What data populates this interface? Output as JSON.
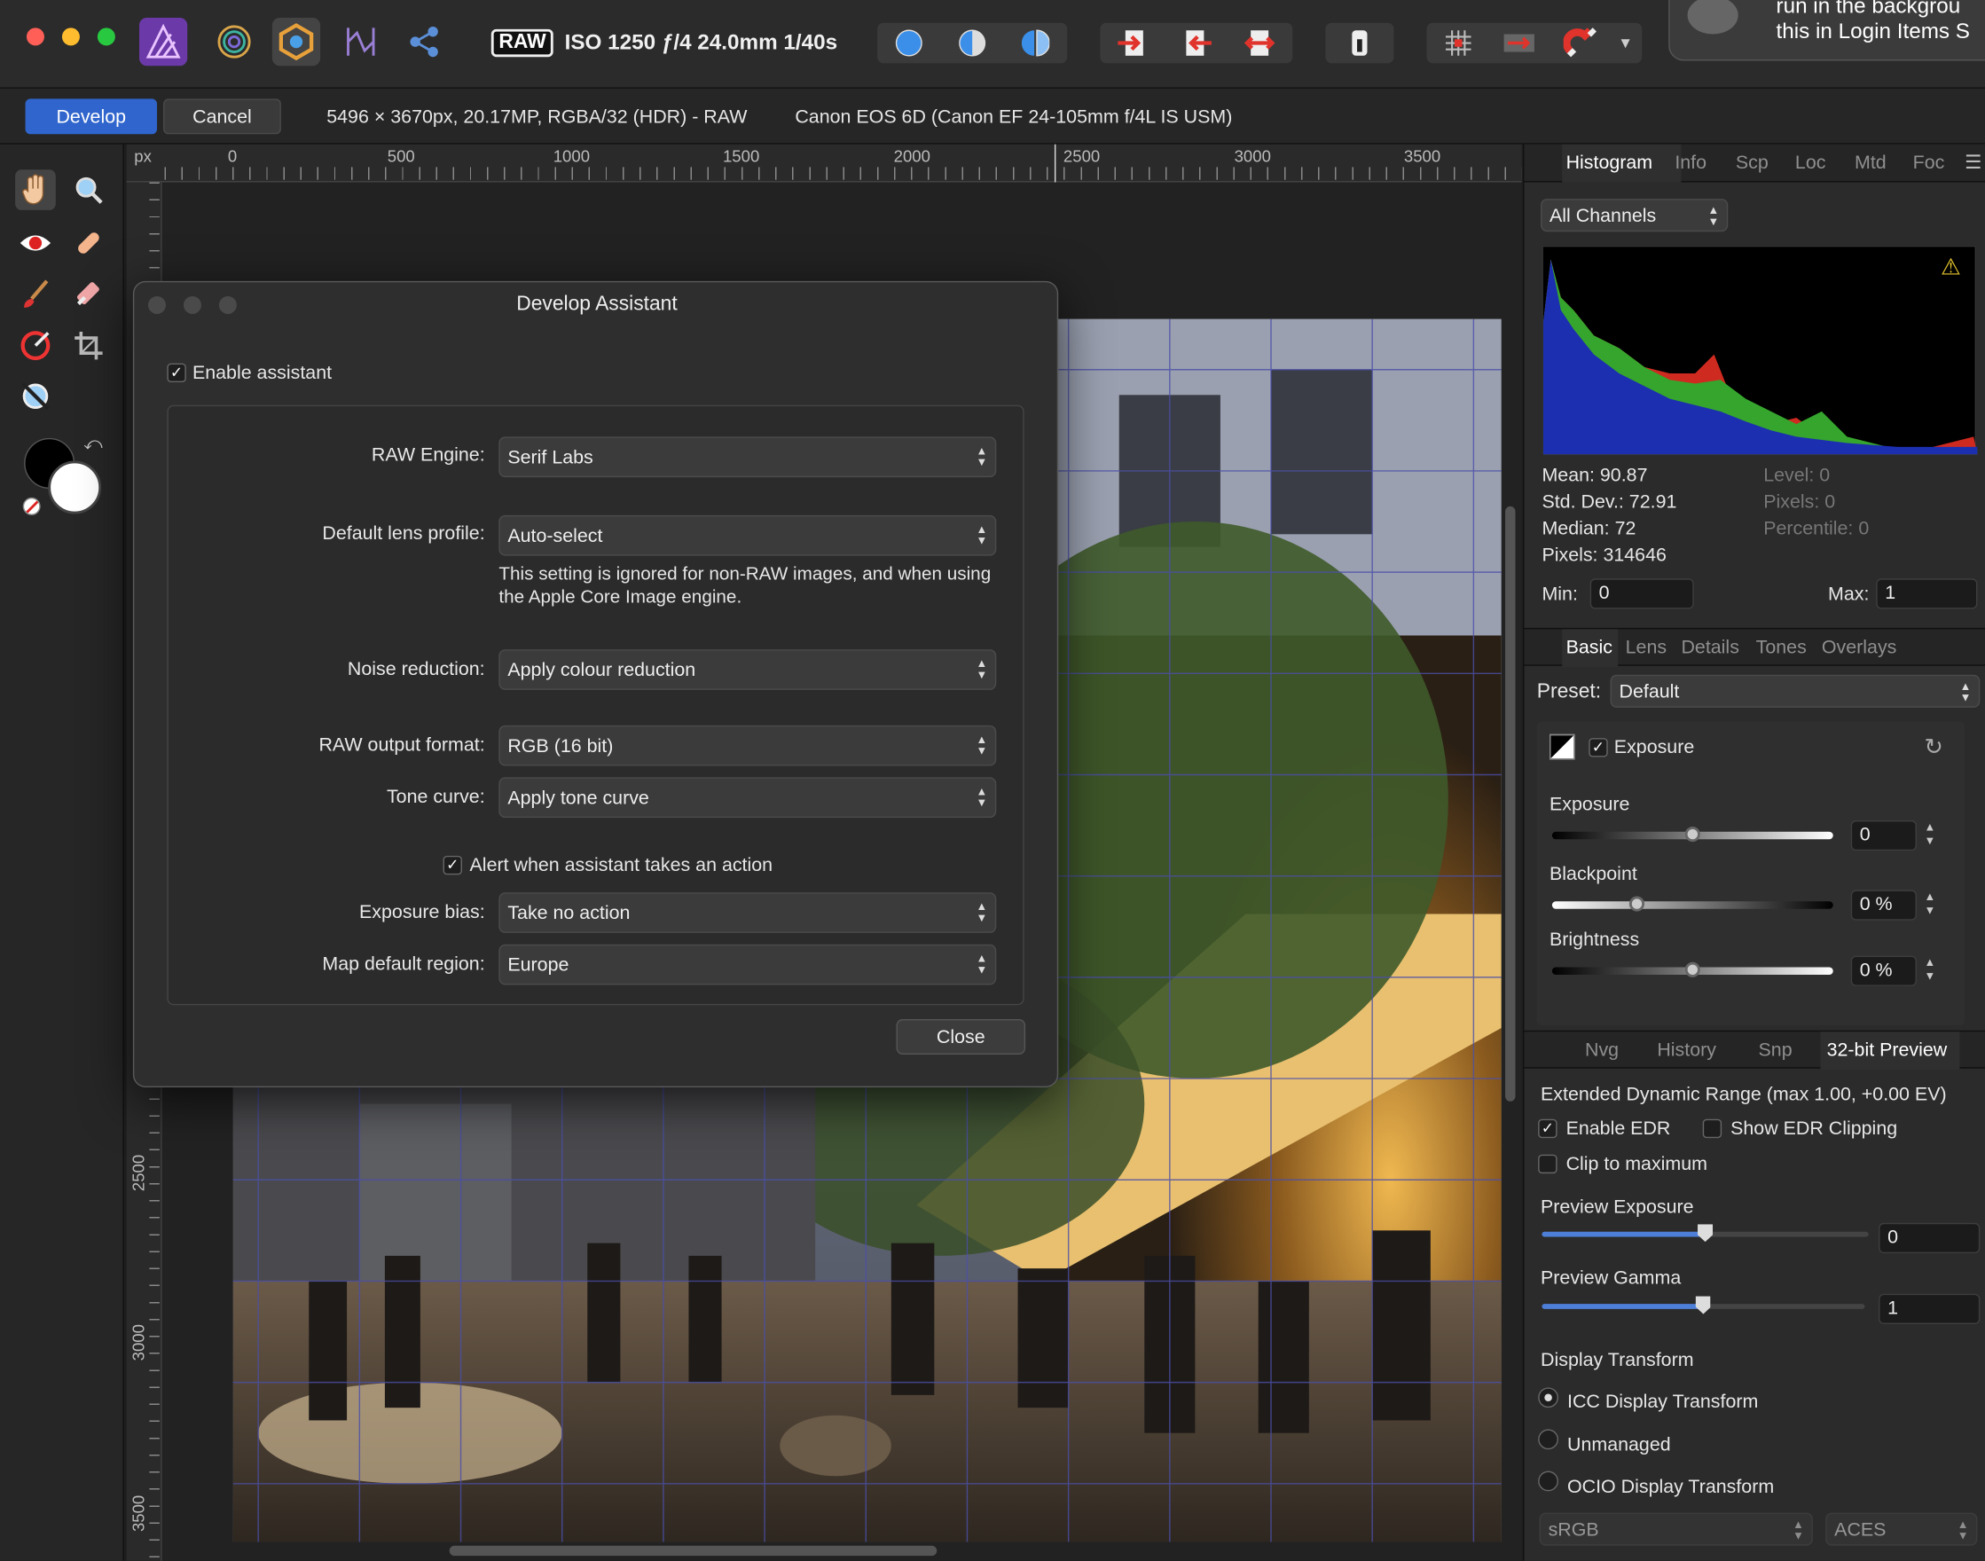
{
  "toolbar": {
    "raw_badge": "RAW",
    "exif": "ISO 1250 ƒ/4 24.0mm 1/40s",
    "notification_line1": "run in the backgrou",
    "notification_line2": "this in Login Items S"
  },
  "context_bar": {
    "develop_label": "Develop",
    "cancel_label": "Cancel",
    "image_info": "5496 × 3670px, 20.17MP, RGBA/32 (HDR) - RAW",
    "camera_info": "Canon EOS 6D (Canon EF 24-105mm f/4L IS USM)"
  },
  "ruler": {
    "unit": "px",
    "top_labels": [
      "0",
      "500",
      "1000",
      "1500",
      "2000",
      "2500",
      "3000",
      "3500"
    ],
    "left_labels": [
      "2500",
      "3000",
      "3500"
    ]
  },
  "dialog": {
    "title": "Develop Assistant",
    "enable_label": "Enable assistant",
    "raw_engine_label": "RAW Engine:",
    "raw_engine_value": "Serif Labs",
    "lens_label": "Default lens profile:",
    "lens_value": "Auto-select",
    "lens_note": "This setting is ignored for non-RAW images, and when using the Apple Core Image engine.",
    "noise_label": "Noise reduction:",
    "noise_value": "Apply colour reduction",
    "output_label": "RAW output format:",
    "output_value": "RGB (16 bit)",
    "tone_label": "Tone curve:",
    "tone_value": "Apply tone curve",
    "alert_label": "Alert when assistant takes an action",
    "bias_label": "Exposure bias:",
    "bias_value": "Take no action",
    "map_label": "Map default region:",
    "map_value": "Europe",
    "close_label": "Close"
  },
  "histogram_panel": {
    "tabs": [
      "Histogram",
      "Info",
      "Scp",
      "Loc",
      "Mtd",
      "Foc"
    ],
    "channel": "All Channels",
    "mean": "Mean: 90.87",
    "stddev": "Std. Dev.: 72.91",
    "median": "Median: 72",
    "pixels": "Pixels: 314646",
    "level": "Level: 0",
    "pixels2": "Pixels: 0",
    "percentile": "Percentile: 0",
    "min_label": "Min:",
    "min_value": "0",
    "max_label": "Max:",
    "max_value": "1"
  },
  "basic_panel": {
    "tabs": [
      "Basic",
      "Lens",
      "Details",
      "Tones",
      "Overlays"
    ],
    "preset_label": "Preset:",
    "preset_value": "Default",
    "section_title": "Exposure",
    "exposure_label": "Exposure",
    "exposure_value": "0",
    "exposure_level": 0.5,
    "blackpoint_label": "Blackpoint",
    "blackpoint_value": "0 %",
    "blackpoint_level": 0.3,
    "brightness_label": "Brightness",
    "brightness_value": "0 %",
    "brightness_level": 0.5
  },
  "preview_panel": {
    "tabs": [
      "Nvg",
      "History",
      "Snp",
      "32-bit Preview"
    ],
    "edr_title": "Extended Dynamic Range (max 1.00, +0.00 EV)",
    "enable_edr": "Enable EDR",
    "show_clipping": "Show EDR Clipping",
    "clip_max": "Clip to maximum",
    "preview_exposure_label": "Preview Exposure",
    "preview_exposure_value": "0",
    "preview_exposure_level": 0.5,
    "preview_gamma_label": "Preview Gamma",
    "preview_gamma_value": "1",
    "preview_gamma_level": 0.5,
    "display_transform_label": "Display Transform",
    "icc_label": "ICC Display Transform",
    "unmanaged_label": "Unmanaged",
    "ocio_label": "OCIO Display Transform",
    "srgb_value": "sRGB",
    "aces_value": "ACES"
  },
  "colors": {
    "accent": "#3d6fd6",
    "dialog_bg": "#2e2e2e",
    "panel_bg": "#2b2b2b"
  }
}
